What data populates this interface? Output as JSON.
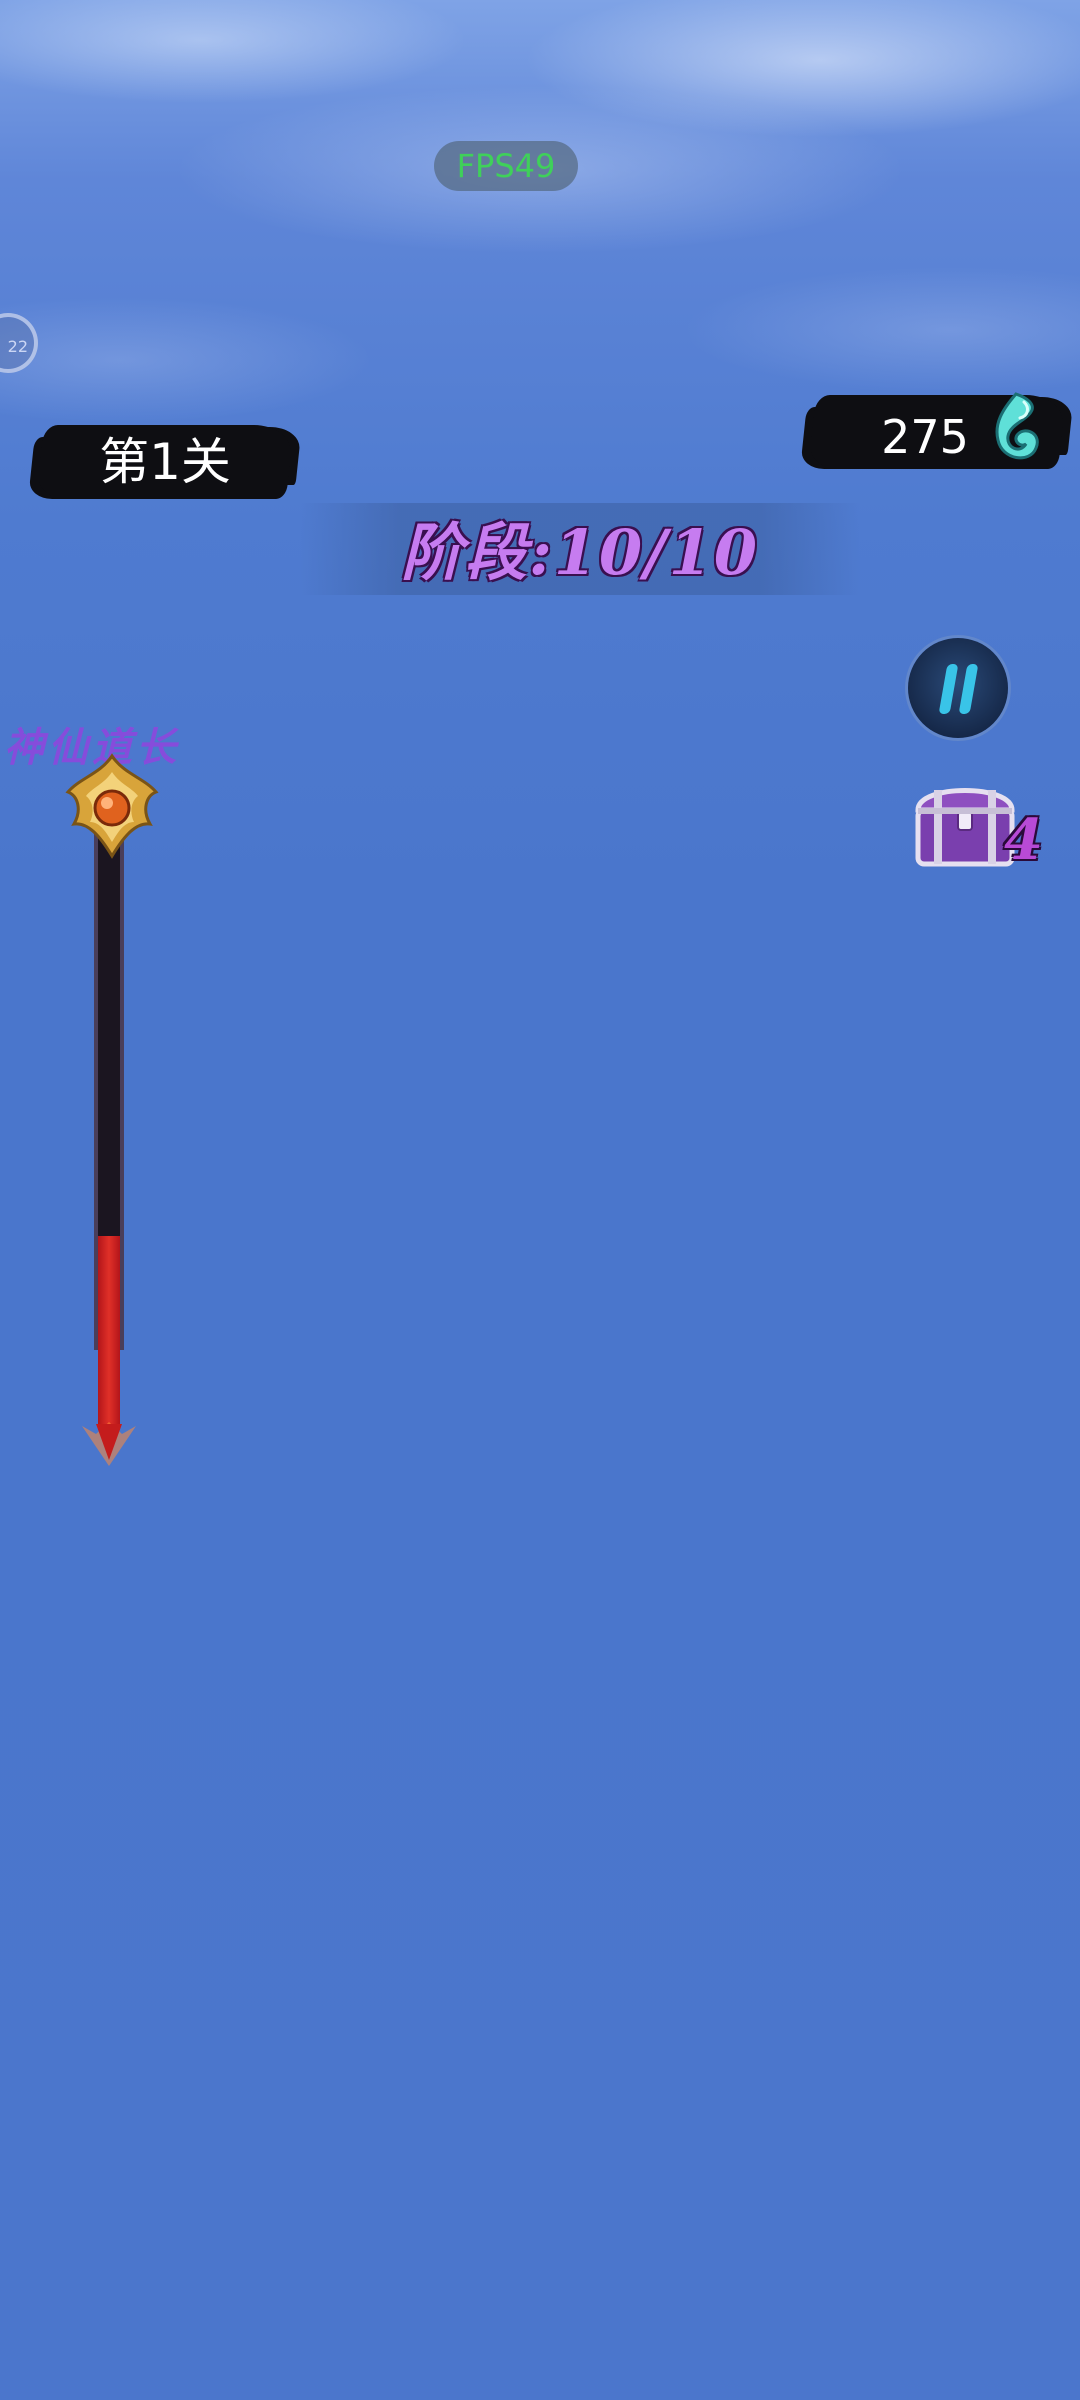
{
  "hud": {
    "fps_label": "FPS49",
    "side_badge_text": "22",
    "level_label": "第1关",
    "coins": "275",
    "stage_label": "阶段:10/10",
    "chest_count": "4",
    "power_label": "神仙道长"
  },
  "gauge": {
    "fill_fraction": 0.22
  },
  "icons": {
    "coin": "spirit-flame-icon",
    "pause": "pause-icon",
    "chest": "treasure-chest-icon",
    "gauge_top": "golden-orb-icon",
    "gauge_tip": "arrow-down-icon"
  },
  "colors": {
    "sky": "#4b76cc",
    "fps_text": "#3fd05a",
    "stage_text": "#c67cf0",
    "gauge_fill": "#e03028",
    "pause_bars": "#39c4e8"
  }
}
